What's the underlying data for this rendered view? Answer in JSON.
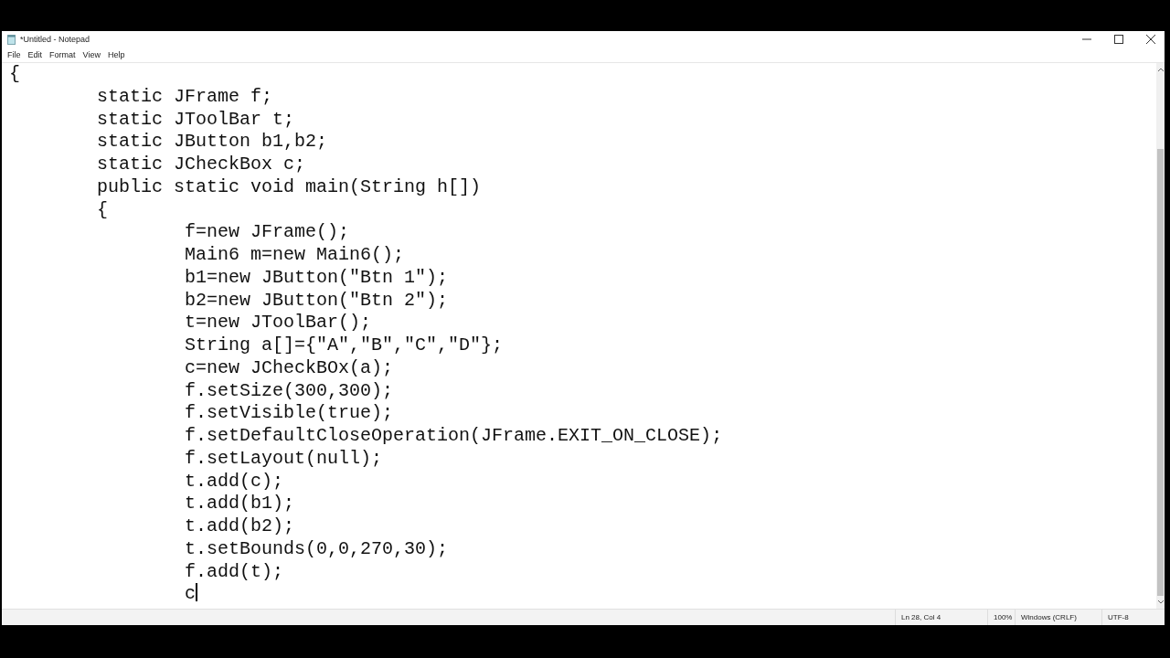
{
  "window": {
    "title": "*Untitled - Notepad"
  },
  "menu": [
    "File",
    "Edit",
    "Format",
    "View",
    "Help"
  ],
  "editor": {
    "lines": [
      "{",
      "\tstatic JFrame f;",
      "\tstatic JToolBar t;",
      "\tstatic JButton b1,b2;",
      "\tstatic JCheckBox c;",
      "\tpublic static void main(String h[])",
      "\t{",
      "\t\tf=new JFrame();",
      "\t\tMain6 m=new Main6();",
      "\t\tb1=new JButton(\"Btn 1\");",
      "\t\tb2=new JButton(\"Btn 2\");",
      "\t\tt=new JToolBar();",
      "\t\tString a[]={\"A\",\"B\",\"C\",\"D\"};",
      "\t\tc=new JCheckBOx(a);",
      "\t\tf.setSize(300,300);",
      "\t\tf.setVisible(true);",
      "\t\tf.setDefaultCloseOperation(JFrame.EXIT_ON_CLOSE);",
      "\t\tf.setLayout(null);",
      "\t\tt.add(c);",
      "\t\tt.add(b1);",
      "\t\tt.add(b2);",
      "\t\tt.setBounds(0,0,270,30);",
      "\t\tf.add(t);",
      "\t\tc"
    ]
  },
  "status_bar": [
    "Ln 28, Col 4",
    "100%",
    "Windows (CRLF)",
    "UTF-8"
  ]
}
